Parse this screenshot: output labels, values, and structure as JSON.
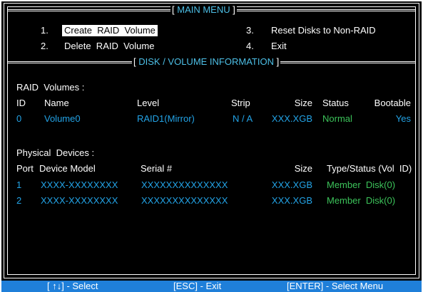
{
  "main_menu": {
    "title": "MAIN MENU",
    "items": [
      {
        "num": "1.",
        "label": "Create  RAID  Volume",
        "selected": true
      },
      {
        "num": "2.",
        "label": "Delete  RAID  Volume",
        "selected": false
      },
      {
        "num": "3.",
        "label": "Reset Disks to Non-RAID",
        "selected": false
      },
      {
        "num": "4.",
        "label": "Exit",
        "selected": false
      }
    ]
  },
  "disk_info": {
    "title": "DISK / VOLUME INFORMATION",
    "raid_volumes": {
      "heading": "RAID  Volumes :",
      "columns": [
        "ID",
        "Name",
        "Level",
        "Strip",
        "Size",
        "Status",
        "Bootable"
      ],
      "rows": [
        {
          "id": "0",
          "name": "Volume0",
          "level": "RAID1(Mirror)",
          "strip": "N / A",
          "size": "XXX.XGB",
          "status": "Normal",
          "bootable": "Yes"
        }
      ]
    },
    "physical_devices": {
      "heading": "Physical  Devices :",
      "columns": [
        "Port",
        "Device Model",
        "Serial #",
        "Size",
        "Type/Status (Vol  ID)"
      ],
      "rows": [
        {
          "port": "1",
          "model": "XXXX-XXXXXXXX",
          "serial": "XXXXXXXXXXXXXX",
          "size": "XXX.XGB",
          "type": "Member  Disk(0)"
        },
        {
          "port": "2",
          "model": "XXXX-XXXXXXXX",
          "serial": "XXXXXXXXXXXXXX",
          "size": "XXX.XGB",
          "type": "Member  Disk(0)"
        }
      ]
    }
  },
  "footer": {
    "select": "[ ↑↓] - Select",
    "exit": "[ESC] - Exit",
    "enter": "[ENTER] - Select Menu"
  },
  "colors": {
    "background": "#000000",
    "frame": "#ffffff",
    "highlight": "#23a3e6",
    "status_ok": "#3cc35a",
    "footer_bar": "#1f7fd9"
  }
}
